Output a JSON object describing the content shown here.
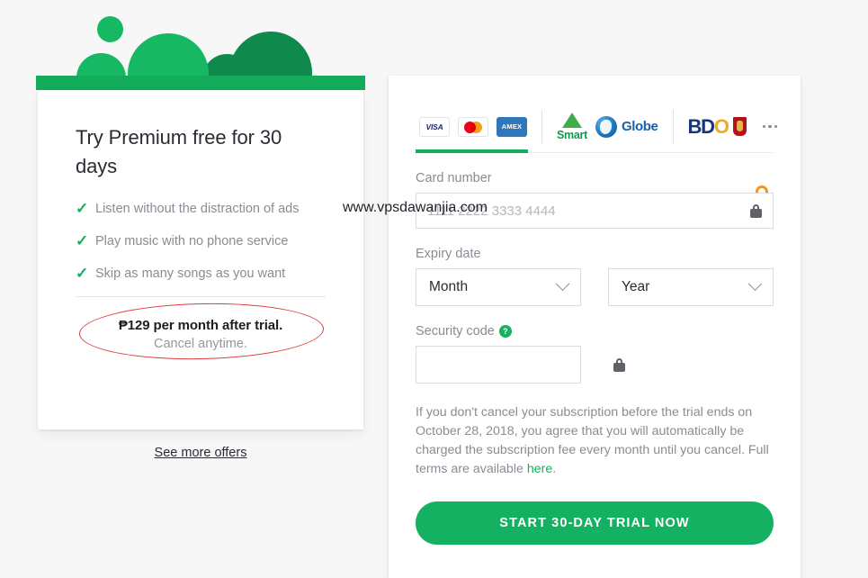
{
  "offer": {
    "title": "Try Premium free for 30 days",
    "benefits": [
      {
        "icon": "check-icon",
        "text": "Listen without the distraction of ads"
      },
      {
        "icon": "check-icon",
        "text": "Play music with no phone service"
      },
      {
        "icon": "check-icon",
        "text": "Skip as many songs as you want"
      }
    ],
    "price_main": "₱129 per month after trial.",
    "price_sub": "Cancel anytime.",
    "see_more_offers": "See more offers",
    "annotation": {
      "shape": "ellipse",
      "color": "#e03a3a"
    }
  },
  "checkout": {
    "payment_tabs": [
      {
        "id": "cards",
        "active": true,
        "brands": [
          {
            "name": "visa-logo",
            "label": "VISA"
          },
          {
            "name": "mastercard-logo",
            "label": ""
          },
          {
            "name": "amex-logo",
            "label": "AMEX"
          }
        ]
      },
      {
        "id": "telco",
        "active": false,
        "brands": [
          {
            "name": "smart-logo",
            "label": "Smart"
          },
          {
            "name": "globe-logo",
            "label": "Globe"
          }
        ]
      },
      {
        "id": "banks",
        "active": false,
        "brands": [
          {
            "name": "bdo-logo",
            "label_b": "BD",
            "label_o": "O"
          },
          {
            "name": "bank-crest-logo",
            "label": ""
          }
        ],
        "more_label": "more-payment-methods"
      }
    ],
    "card_number": {
      "label": "Card number",
      "value": "",
      "placeholder": "1111 2222 3333 4444"
    },
    "expiry": {
      "label": "Expiry date",
      "month_value": "Month",
      "year_value": "Year"
    },
    "security_code": {
      "label": "Security code",
      "value": "",
      "placeholder": "",
      "help_glyph": "?"
    },
    "terms_text": "If you don't cancel your subscription before the trial ends on October 28, 2018, you agree that you will automatically be charged the subscription fee every month until you cancel. Full terms are available ",
    "terms_link": "here",
    "terms_text_end": ".",
    "cta_label": "START 30-DAY TRIAL NOW"
  },
  "watermark": "www.vpsdawanjia.com",
  "colors": {
    "brand_green": "#13b161",
    "dark_green": "#0f8a4c",
    "annotation_red": "#e03a3a",
    "lock_orange": "#f7941e"
  }
}
